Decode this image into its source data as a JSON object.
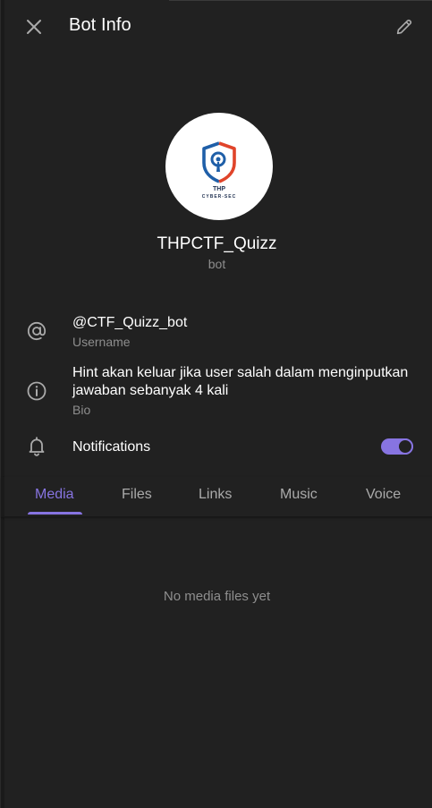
{
  "header": {
    "title": "Bot Info",
    "close_icon": "close-icon",
    "edit_icon": "pencil-icon"
  },
  "profile": {
    "name": "THPCTF_Quizz",
    "status": "bot",
    "avatar": {
      "logo_text_top": "THP",
      "logo_text_bottom": "CYBER-SEC",
      "colors": {
        "blue": "#1f5fa8",
        "red": "#e0442a",
        "background": "#ffffff"
      }
    }
  },
  "info": {
    "username": {
      "value": "@CTF_Quizz_bot",
      "label": "Username",
      "icon": "at-icon"
    },
    "bio": {
      "value_line1": "Hint akan keluar jika user salah dalam menginputkan",
      "value_line2": "jawaban sebanyak 4 kali",
      "label": "Bio",
      "icon": "info-icon"
    },
    "notifications": {
      "label": "Notifications",
      "icon": "bell-icon",
      "enabled": true
    }
  },
  "tabs": [
    {
      "label": "Media",
      "active": true
    },
    {
      "label": "Files",
      "active": false
    },
    {
      "label": "Links",
      "active": false
    },
    {
      "label": "Music",
      "active": false
    },
    {
      "label": "Voice",
      "active": false
    }
  ],
  "empty_state": "No media files yet",
  "colors": {
    "background": "#212121",
    "accent": "#8774e1",
    "secondary_text": "#8e8e8e"
  }
}
